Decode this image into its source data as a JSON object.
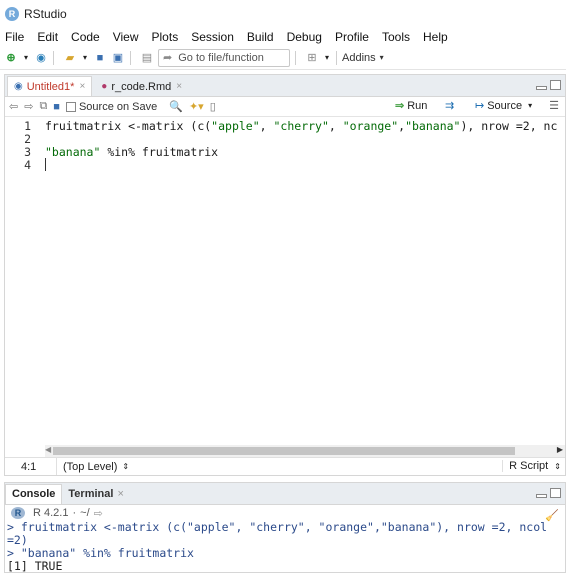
{
  "window": {
    "logo_letter": "R",
    "title": "RStudio"
  },
  "menu": [
    "File",
    "Edit",
    "Code",
    "View",
    "Plots",
    "Session",
    "Build",
    "Debug",
    "Profile",
    "Tools",
    "Help"
  ],
  "toolbar": {
    "goto_placeholder": "Go to file/function",
    "addins_label": "Addins"
  },
  "editor": {
    "tabs": [
      {
        "label": "Untitled1*",
        "active": true
      },
      {
        "label": "r_code.Rmd",
        "active": false
      }
    ],
    "source_on_save_label": "Source on Save",
    "run_label": "Run",
    "source_label": "Source",
    "line_numbers": [
      "1",
      "2",
      "3",
      "4"
    ],
    "lines": [
      "fruitmatrix <-matrix (c(\"apple\", \"cherry\", \"orange\",\"banana\"), nrow =2, nc",
      "",
      "\"banana\" %in% fruitmatrix",
      ""
    ],
    "status": {
      "position": "4:1",
      "scope": "(Top Level)",
      "file_type": "R Script"
    }
  },
  "console": {
    "tabs": [
      {
        "label": "Console",
        "active": true
      },
      {
        "label": "Terminal",
        "active": false
      }
    ],
    "r_version": "R 4.2.1",
    "working_dir": "~/",
    "output_lines": [
      "> fruitmatrix <-matrix (c(\"apple\", \"cherry\", \"orange\",\"banana\"), nrow =2, ncol",
      "=2)",
      "> \"banana\" %in% fruitmatrix",
      "[1] TRUE"
    ]
  },
  "colors": {
    "string": "#036a07",
    "console_input": "#2b4a8a",
    "run_arrow": "#4aa34a",
    "accent": "#75aadb"
  }
}
